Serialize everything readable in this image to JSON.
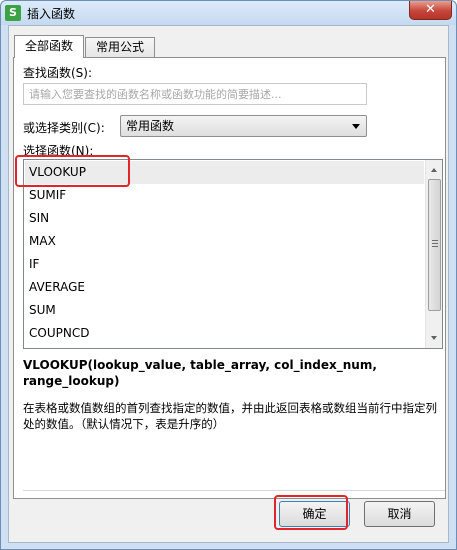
{
  "window": {
    "title": "插入函数",
    "app_icon_letter": "S",
    "close_symbol": "✕"
  },
  "tabs": [
    {
      "label": "全部函数",
      "active": true
    },
    {
      "label": "常用公式",
      "active": false
    }
  ],
  "search": {
    "label": "查找函数(S):",
    "placeholder": "请输入您要查找的函数名称或函数功能的简要描述...",
    "value": ""
  },
  "category": {
    "label": "或选择类别(C):",
    "selected": "常用函数"
  },
  "function_list": {
    "label": "选择函数(N):",
    "items": [
      "VLOOKUP",
      "SUMIF",
      "SIN",
      "MAX",
      "IF",
      "AVERAGE",
      "SUM",
      "COUPNCD"
    ],
    "selected": "VLOOKUP"
  },
  "signature": "VLOOKUP(lookup_value, table_array, col_index_num, range_lookup)",
  "description": "在表格或数值数组的首列查找指定的数值，并由此返回表格或数组当前行中指定列处的数值。（默认情况下，表是升序的）",
  "buttons": {
    "ok": "确定",
    "cancel": "取消"
  },
  "colors": {
    "highlight": "#e0252b",
    "title_bar": "#c5d9ef",
    "close_button": "#c7453a",
    "app_icon": "#3aa344"
  }
}
